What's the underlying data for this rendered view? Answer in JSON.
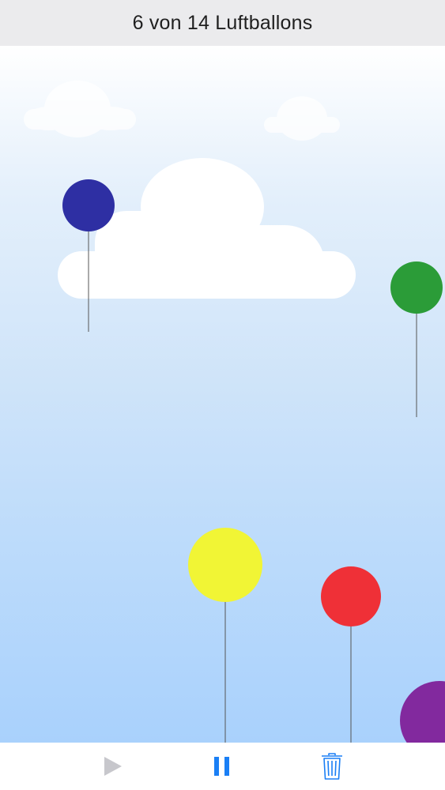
{
  "header": {
    "title": "6 von 14 Luftballons"
  },
  "balloons": [
    {
      "color": "#2e2fa3",
      "name": "blue"
    },
    {
      "color": "#2b9c38",
      "name": "green"
    },
    {
      "color": "#f1f535",
      "name": "yellow"
    },
    {
      "color": "#ef3037",
      "name": "red"
    },
    {
      "color": "#82299e",
      "name": "purple"
    }
  ],
  "toolbar": {
    "play_icon": "play-icon",
    "pause_icon": "pause-icon",
    "trash_icon": "trash-icon",
    "play_color": "#c7c7cc",
    "accent_color": "#1a7ff5"
  }
}
